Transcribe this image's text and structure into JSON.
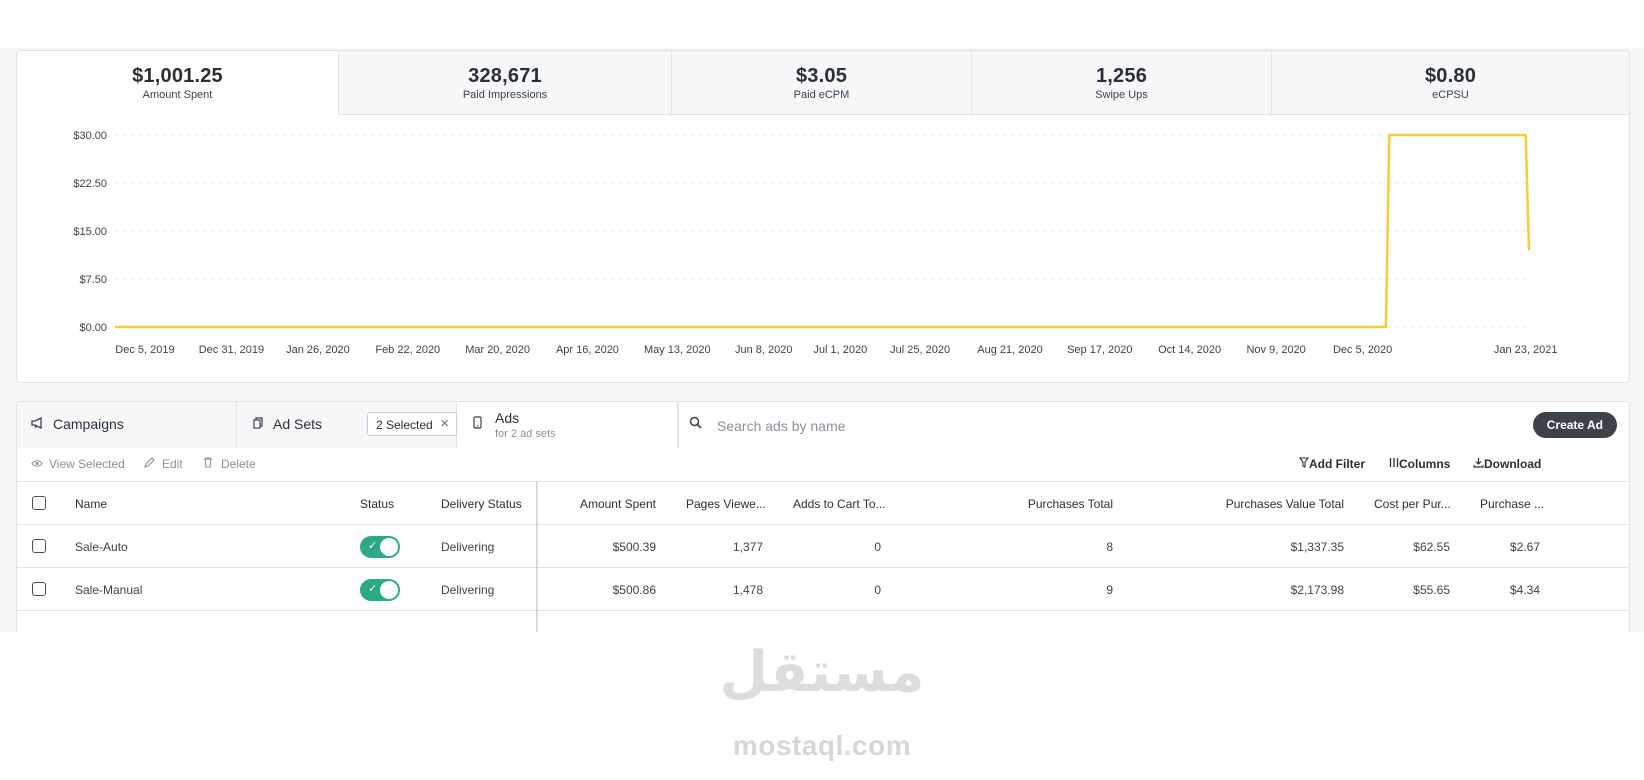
{
  "metrics": [
    {
      "value": "$1,001.25",
      "label": "Amount Spent",
      "active": true
    },
    {
      "value": "328,671",
      "label": "Paid Impressions"
    },
    {
      "value": "$3.05",
      "label": "Paid eCPM"
    },
    {
      "value": "1,256",
      "label": "Swipe Ups"
    },
    {
      "value": "$0.80",
      "label": "eCPSU"
    }
  ],
  "chart_data": {
    "type": "line",
    "title": "",
    "xlabel": "",
    "ylabel": "",
    "series_color": "#f5cd3b",
    "grid": true,
    "y_ticks": [
      "$0.00",
      "$7.50",
      "$15.00",
      "$22.50",
      "$30.00"
    ],
    "y_tick_values": [
      0,
      7.5,
      15,
      22.5,
      30
    ],
    "ylim": [
      0,
      30
    ],
    "x_ticks": [
      "Dec 5, 2019",
      "Dec 31, 2019",
      "Jan 26, 2020",
      "Feb 22, 2020",
      "Mar 20, 2020",
      "Apr 16, 2020",
      "May 13, 2020",
      "Jun 8, 2020",
      "Jul 1, 2020",
      "Jul 25, 2020",
      "Aug 21, 2020",
      "Sep 17, 2020",
      "Oct 14, 2020",
      "Nov 9, 2020",
      "Dec 5, 2020",
      "Jan 23, 2021"
    ],
    "x_tick_dates": [
      "2019-12-05",
      "2019-12-31",
      "2020-01-26",
      "2020-02-22",
      "2020-03-20",
      "2020-04-16",
      "2020-05-13",
      "2020-06-08",
      "2020-07-01",
      "2020-07-25",
      "2020-08-21",
      "2020-09-17",
      "2020-10-14",
      "2020-11-09",
      "2020-12-05",
      "2021-01-23"
    ],
    "xlim": [
      "2019-11-26",
      "2021-01-24"
    ],
    "points": [
      {
        "x": "2019-11-26",
        "y": 0
      },
      {
        "x": "2020-12-12",
        "y": 0
      },
      {
        "x": "2020-12-13",
        "y": 30
      },
      {
        "x": "2021-01-23",
        "y": 30
      },
      {
        "x": "2021-01-24",
        "y": 12
      }
    ]
  },
  "nav": {
    "campaigns_label": "Campaigns",
    "adsets_label": "Ad Sets",
    "selected_label": "2 Selected",
    "ads_label": "Ads",
    "ads_sub": "for 2 ad sets",
    "search_placeholder": "Search ads by name",
    "create_label": "Create Ad"
  },
  "toolbar": {
    "view_selected": "View Selected",
    "edit": "Edit",
    "delete": "Delete",
    "add_filter": "Add Filter",
    "columns": "Columns",
    "download": "Download"
  },
  "table": {
    "columns": [
      "Name",
      "Status",
      "Delivery Status",
      "Amount Spent",
      "Pages Viewe...",
      "Adds to Cart To...",
      "Purchases Total",
      "Purchases Value Total",
      "Cost per Pur...",
      "Purchase ..."
    ],
    "rows": [
      {
        "name": "Sale-Auto",
        "status_on": true,
        "delivery": "Delivering",
        "amount": "$500.39",
        "pages": "1,377",
        "adds": "0",
        "purchases": "8",
        "value": "$1,337.35",
        "cost": "$62.55",
        "purchase": "$2.67"
      },
      {
        "name": "Sale-Manual",
        "status_on": true,
        "delivery": "Delivering",
        "amount": "$500.86",
        "pages": "1,478",
        "adds": "0",
        "purchases": "9",
        "value": "$2,173.98",
        "cost": "$55.65",
        "purchase": "$4.34"
      }
    ]
  },
  "watermark": {
    "arabic": "مستقل",
    "latin": "mostaql.com"
  }
}
